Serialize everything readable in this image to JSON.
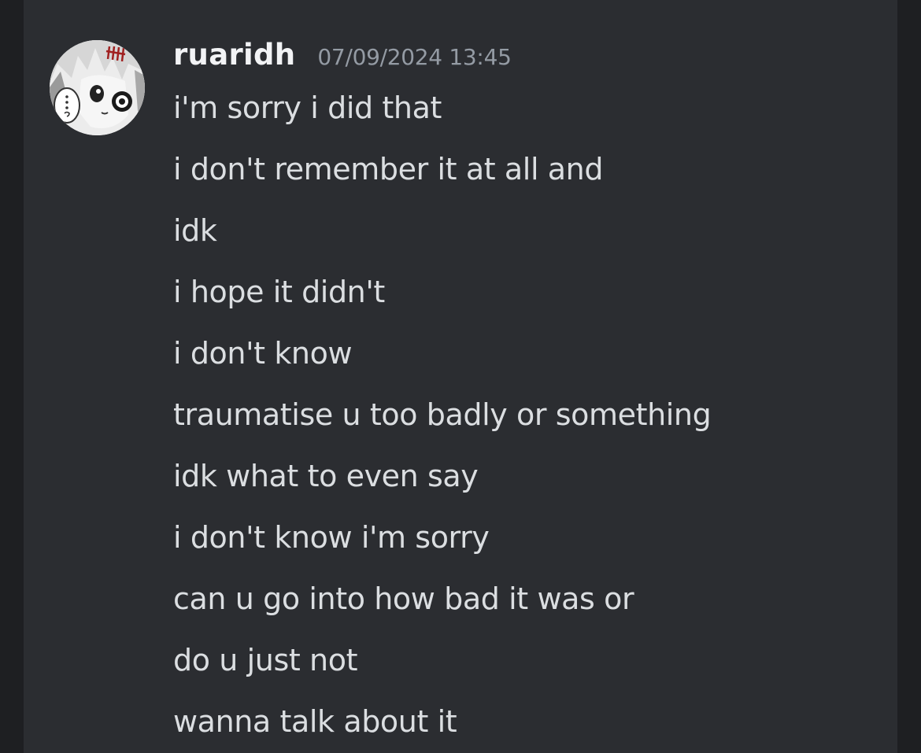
{
  "message": {
    "author": "ruaridh",
    "timestamp": "07/09/2024 13:45",
    "avatar_icon": "anime-character-avatar",
    "lines": [
      "i'm sorry i did that",
      "i don't remember it at all and",
      "idk",
      "i hope it didn't",
      "i don't know",
      "traumatise u too badly or something",
      "idk what to even say",
      "i don't know i'm sorry",
      "can u go into how bad it was or",
      "do u just not",
      "wanna talk about it"
    ]
  },
  "colors": {
    "background": "#2b2d31",
    "outer_background": "#1e1f22",
    "username": "#f2f3f5",
    "timestamp": "#949ba4",
    "text": "#dbdee1"
  }
}
